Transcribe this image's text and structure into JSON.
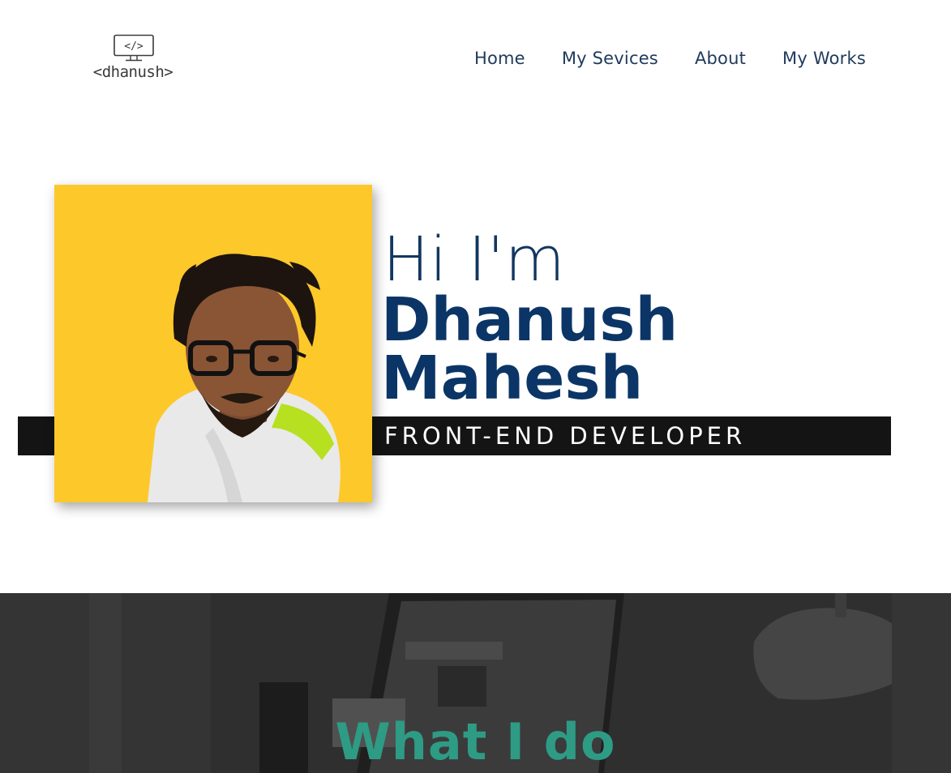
{
  "brand": {
    "logo_text": "<dhanush>",
    "logo_icon": "code-monitor-icon"
  },
  "nav": {
    "items": [
      {
        "label": "Home"
      },
      {
        "label": "My Sevices"
      },
      {
        "label": "About"
      },
      {
        "label": "My Works"
      }
    ]
  },
  "hero": {
    "greeting": "Hi I'm",
    "first_name": "Dhanush",
    "last_name": "Mahesh",
    "role": "FRONT-END DEVELOPER",
    "photo_bg_color": "#fdc82a"
  },
  "services": {
    "title": "What I do",
    "title_color": "#2e9b84"
  },
  "colors": {
    "nav_text": "#1f3a5c",
    "name_text": "#0b3566",
    "band": "#141414"
  }
}
